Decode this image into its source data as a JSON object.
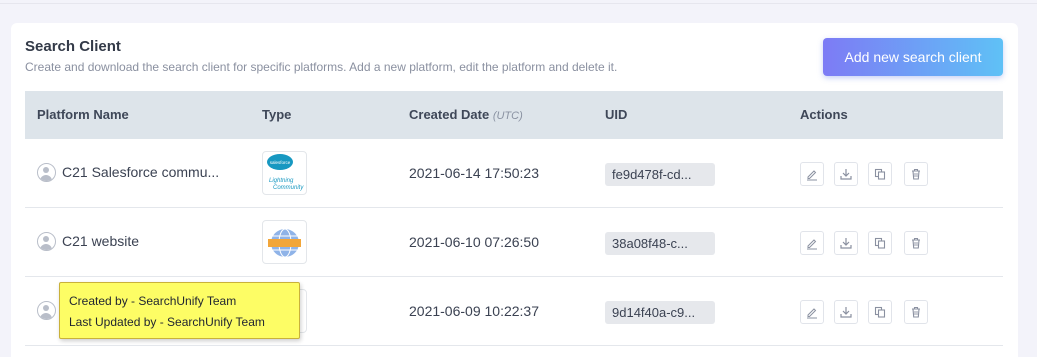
{
  "card": {
    "title": "Search Client",
    "subtitle": "Create and download the search client for specific platforms. Add a new platform, edit the platform and delete it.",
    "add_button": "Add new search client"
  },
  "table": {
    "headers": {
      "platform_name": "Platform Name",
      "type": "Type",
      "created_date": "Created Date",
      "created_date_note": "(UTC)",
      "uid": "UID",
      "actions": "Actions"
    },
    "rows": [
      {
        "name": "C21 Salesforce commu...",
        "type_icon": "salesforce-lightning-community-logo",
        "type_logo_text_1": "salesforce",
        "type_logo_text_2": "Lightning",
        "type_logo_text_3": "Community",
        "date": "2021-06-14 17:50:23",
        "uid": "fe9d478f-cd..."
      },
      {
        "name": "C21 website",
        "type_icon": "website-globe-logo",
        "date": "2021-06-10 07:26:50",
        "uid": "38a08f48-c..."
      },
      {
        "name": "",
        "type_icon": "partially-hidden-logo",
        "date": "2021-06-09 10:22:37",
        "uid": "9d14f40a-c9..."
      }
    ]
  },
  "tooltip": {
    "created_by": "Created by - SearchUnify Team",
    "updated_by": "Last Updated by - SearchUnify Team"
  },
  "colors": {
    "button_gradient_start": "#7d7bf5",
    "button_gradient_end": "#5fc1f6",
    "header_bg": "#dde4ea",
    "tooltip_bg": "#fdfd65"
  },
  "icons": [
    "user-status-icon",
    "edit-icon",
    "download-icon",
    "copy-icon",
    "delete-icon"
  ]
}
